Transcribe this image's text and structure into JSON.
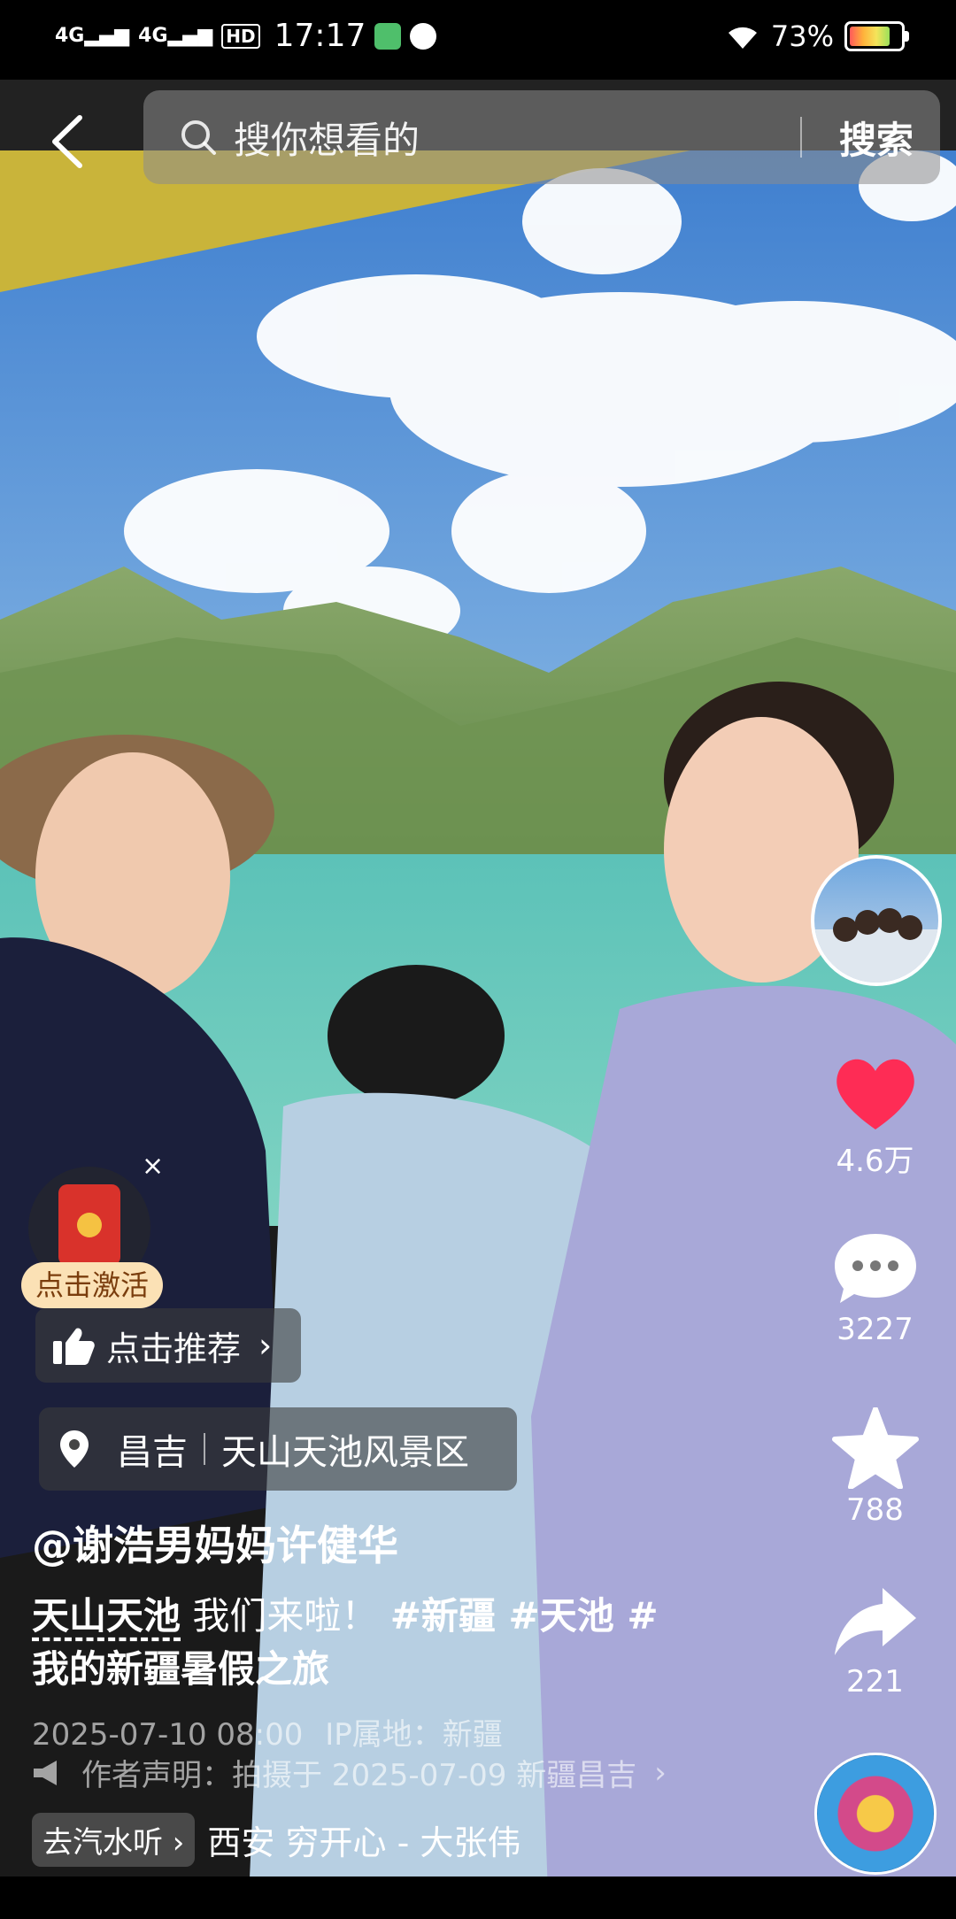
{
  "status_bar": {
    "network1": "4G",
    "network2": "4G",
    "hd": "HD",
    "time": "17:17",
    "battery": "73%",
    "battery_level": 0.73
  },
  "search": {
    "placeholder": "搜你想看的",
    "button": "搜索"
  },
  "actions": {
    "likes": "4.6万",
    "comments": "3227",
    "favorites": "788",
    "shares": "221"
  },
  "promo": {
    "activate_label": "点击激活",
    "close": "×"
  },
  "recommend_label": "点击推荐",
  "location": {
    "city": "昌吉",
    "place": "天山天池风景区"
  },
  "post": {
    "author": "@谢浩男妈妈许健华",
    "link_text": "天山天池",
    "caption": " 我们来啦！ ",
    "hashtags": "#新疆 #天池 #",
    "hashtags_line2": "我的新疆暑假之旅",
    "datetime": "2025-07-10 08:00",
    "ip_location": "IP属地：新疆",
    "declaration": "作者声明：拍摄于 2025-07-09 新疆昌吉"
  },
  "music": {
    "tag": "去汽水听",
    "title": "西安 穷开心 - 大张伟"
  },
  "colors": {
    "like": "#fe2c55",
    "activate_bg": "#fbe1b5"
  }
}
